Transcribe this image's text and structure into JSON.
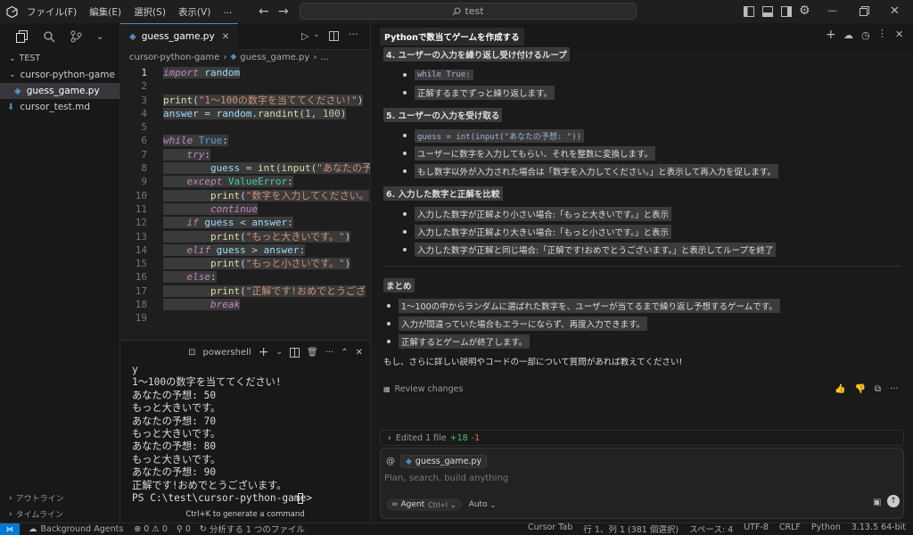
{
  "menu": [
    "ファイル(F)",
    "編集(E)",
    "選択(S)",
    "表示(V)",
    "..."
  ],
  "search": {
    "placeholder": "test"
  },
  "explorer": {
    "root": "TEST",
    "folder": "cursor-python-game",
    "files": [
      "guess_game.py",
      "cursor_test.md"
    ],
    "outline": "アウトライン",
    "timeline": "タイムライン"
  },
  "editor": {
    "tab": "guess_game.py",
    "breadcrumb": [
      "cursor-python-game",
      "guess_game.py",
      "..."
    ],
    "lines": [
      {
        "n": "1",
        "code": "import random"
      },
      {
        "n": "2",
        "code": ""
      },
      {
        "n": "3",
        "code": "print(\"1〜100の数字を当ててください!\")"
      },
      {
        "n": "4",
        "code": "answer = random.randint(1, 100)"
      },
      {
        "n": "5",
        "code": ""
      },
      {
        "n": "6",
        "code": "while True:"
      },
      {
        "n": "7",
        "code": "    try:"
      },
      {
        "n": "8",
        "code": "        guess = int(input(\"あなたの予想"
      },
      {
        "n": "9",
        "code": "    except ValueError:"
      },
      {
        "n": "10",
        "code": "        print(\"数字を入力してください。"
      },
      {
        "n": "11",
        "code": "        continue"
      },
      {
        "n": "12",
        "code": "    if guess < answer:"
      },
      {
        "n": "13",
        "code": "        print(\"もっと大きいです。\")"
      },
      {
        "n": "14",
        "code": "    elif guess > answer:"
      },
      {
        "n": "15",
        "code": "        print(\"もっと小さいです。\")"
      },
      {
        "n": "16",
        "code": "    else:"
      },
      {
        "n": "17",
        "code": "        print(\"正解です!おめでとうござ"
      },
      {
        "n": "18",
        "code": "        break"
      },
      {
        "n": "19",
        "code": ""
      }
    ]
  },
  "terminal": {
    "label": "powershell",
    "lines": [
      "y",
      "1〜100の数字を当ててください!",
      "あなたの予想: 50",
      "もっと大きいです。",
      "あなたの予想: 70",
      "もっと大きいです。",
      "あなたの予想: 80",
      "もっと大きいです。",
      "あなたの予想: 90",
      "正解です!おめでとうございます。",
      "PS C:\\test\\cursor-python-game> "
    ],
    "hint": "Ctrl+K to generate a command"
  },
  "chat": {
    "tab": "Pythonで数当てゲームを作成する",
    "sections": [
      {
        "heading": "4. ユーザーの入力を繰り返し受け付けるループ",
        "bullets": [
          {
            "text": "while True:",
            "code": true
          },
          {
            "text": "正解するまでずっと繰り返します。",
            "code": false
          }
        ]
      },
      {
        "heading": "5. ユーザーの入力を受け取る",
        "bullets": [
          {
            "text": "guess = int(input(\"あなたの予想: \"))",
            "code": true
          },
          {
            "text": "ユーザーに数字を入力してもらい、それを整数に変換します。",
            "code": false
          },
          {
            "text": "もし数字以外が入力された場合は「数字を入力してください。」と表示して再入力を促します。",
            "code": false
          }
        ]
      },
      {
        "heading": "6. 入力した数字と正解を比較",
        "bullets": [
          {
            "text": "入力した数字が正解より小さい場合:「もっと大きいです。」と表示",
            "code": false
          },
          {
            "text": "入力した数字が正解より大きい場合:「もっと小さいです。」と表示",
            "code": false
          },
          {
            "text": "入力した数字が正解と同じ場合:「正解です!おめでとうございます。」と表示してループを終了",
            "code": false
          }
        ]
      }
    ],
    "summary_heading": "まとめ",
    "summary": [
      "1〜100の中からランダムに選ばれた数字を、ユーザーが当てるまで繰り返し予想するゲームです。",
      "入力が間違っていた場合もエラーにならず、再度入力できます。",
      "正解するとゲームが終了します。"
    ],
    "closing": "もし、さらに詳しい説明やコードの一部について質問があれば教えてください!",
    "review": "Review changes",
    "edited": "Edited 1 file",
    "added": "+18",
    "removed": "-1",
    "context_file": "guess_game.py",
    "input_placeholder": "Plan, search, build anything",
    "agent": "Agent",
    "agent_shortcut": "Ctrl+I",
    "auto": "Auto"
  },
  "status": {
    "agents": "Background Agents",
    "errors": "0",
    "warnings": "0",
    "ports": "0",
    "analyzing": "分析する 1 つのファイル",
    "cursor_tab": "Cursor Tab",
    "position": "行 1、列 1 (381 個選択)",
    "spaces": "スペース: 4",
    "encoding": "UTF-8",
    "eol": "CRLF",
    "language": "Python",
    "version": "3.13.5 64-bit"
  }
}
